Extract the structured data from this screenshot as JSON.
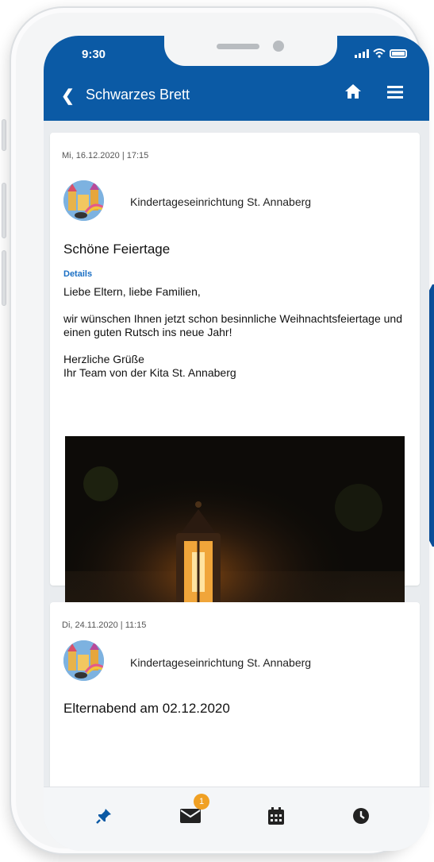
{
  "status_bar": {
    "time": "9:30"
  },
  "header": {
    "title": "Schwarzes Brett"
  },
  "posts": [
    {
      "date": "Mi, 16.12.2020 | 17:15",
      "organization": "Kindertageseinrichtung St. Annaberg",
      "title": "Schöne Feiertage",
      "details_label": "Details",
      "body": "Liebe Eltern, liebe Familien,\n\nwir wünschen Ihnen jetzt schon besinnliche Weihnachtsfeiertage und einen guten Rutsch ins neue Jahr!\n\nHerzliche Grüße\nIhr Team von der Kita St. Annaberg",
      "image_icon": "lantern-photo"
    },
    {
      "date": "Di, 24.11.2020 | 11:15",
      "organization": "Kindertageseinrichtung St. Annaberg",
      "title_partial": "Elternabend am 02.12.2020"
    }
  ],
  "tab_bar": {
    "tabs": [
      {
        "icon": "pin-icon",
        "active": true
      },
      {
        "icon": "envelope-icon",
        "badge": "1"
      },
      {
        "icon": "calendar-icon"
      },
      {
        "icon": "clock-icon"
      }
    ]
  },
  "colors": {
    "primary": "#0b5aa5",
    "accent_blue": "#0a4f9b",
    "badge": "#f0a023",
    "link": "#1a6fc4"
  }
}
